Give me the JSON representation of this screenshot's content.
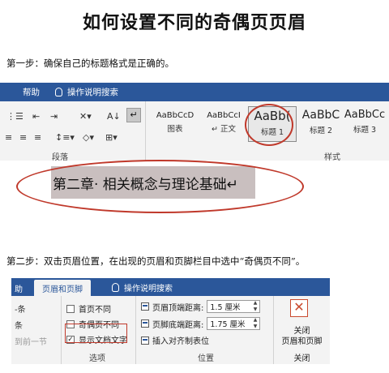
{
  "title": "如何设置不同的奇偶页页眉",
  "step1": "第一步：确保自己的标题格式是正确的。",
  "step2": "第二步：双击页眉位置，在出现的页眉和页脚栏目中选中“奇偶页不同”。",
  "ribbon1": {
    "tab_help": "帮助",
    "tell_me": "操作说明搜索",
    "paragraph_label": "段落",
    "styles_label": "样式",
    "styles": [
      {
        "sample": "AaBbCcD",
        "name": "图表"
      },
      {
        "sample": "AaBbCcI",
        "name": "↵ 正文"
      },
      {
        "sample": "AaBb(",
        "name": "标题 1"
      },
      {
        "sample": "AaBbC",
        "name": "标题 2"
      },
      {
        "sample": "AaBbCc",
        "name": "标题 3"
      }
    ]
  },
  "heading_sample": "第二章· 相关概念与理论基础↵",
  "ribbon2": {
    "tab_prev": "助",
    "tab_active": "页眉和页脚",
    "tell_me": "操作说明搜索",
    "nav_items": [
      "-条",
      "条",
      "到前一节"
    ],
    "options": [
      {
        "label": "首页不同",
        "checked": false
      },
      {
        "label": "奇偶页不同",
        "checked": false
      },
      {
        "label": "显示文档文字",
        "checked": true
      }
    ],
    "options_label": "选项",
    "header_top_label": "页眉顶端距离:",
    "header_top_value": "1.5 厘米",
    "footer_bottom_label": "页脚底端距离:",
    "footer_bottom_value": "1.75 厘米",
    "insert_tab": "插入对齐制表位",
    "position_label": "位置",
    "close_line1": "关闭",
    "close_line2": "页眉和页脚",
    "close_group_label": "关闭"
  },
  "colors": {
    "ribbon_blue": "#2b579a",
    "annotation_red": "#c0392b"
  }
}
